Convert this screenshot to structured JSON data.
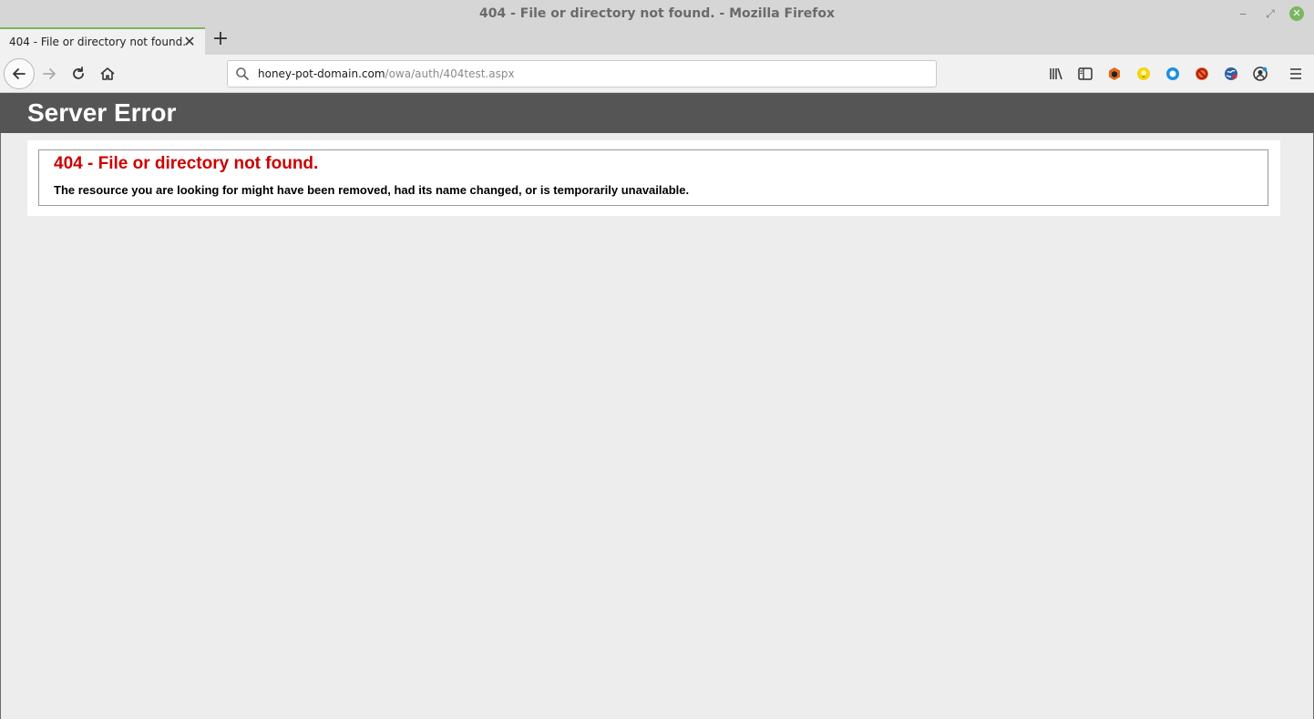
{
  "window": {
    "title": "404 - File or directory not found. - Mozilla Firefox",
    "minimize_glyph": "‒",
    "maximize_glyph": "⤢",
    "close_glyph": "✕"
  },
  "tabs": [
    {
      "label": "404 - File or directory not found.",
      "active": true
    }
  ],
  "tab_close_glyph": "✕",
  "new_tab_glyph": "+",
  "urlbar": {
    "host": "honey-pot-domain.com",
    "path": "/owa/auth/404test.aspx"
  },
  "toolbar_icons": [
    "library-icon",
    "sidebar-icon",
    "extension-orange-icon",
    "extension-lightbulb-icon",
    "extension-blue-ring-icon",
    "extension-blocked-icon",
    "extension-globe-icon",
    "extension-account-icon",
    "menu-icon"
  ],
  "page": {
    "header_title": "Server Error",
    "error_title": "404 - File or directory not found.",
    "error_message": "The resource you are looking for might have been removed, had its name changed, or is temporarily unavailable."
  },
  "colors": {
    "header_bg": "#555555",
    "error_title": "#cc0000",
    "tab_accent": "#7bb661"
  }
}
